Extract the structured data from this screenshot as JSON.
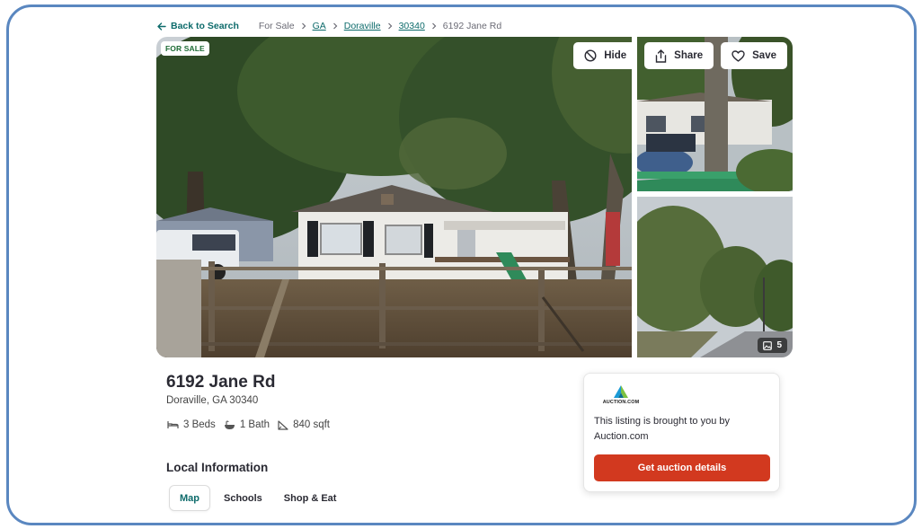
{
  "breadcrumb": {
    "back_label": "Back to Search",
    "items": [
      "For Sale",
      "GA",
      "Doraville",
      "30340",
      "6192 Jane Rd"
    ]
  },
  "gallery": {
    "sale_badge": "FOR SALE",
    "hide_label": "Hide",
    "share_label": "Share",
    "save_label": "Save",
    "photo_count": "5",
    "icons": [
      "hide-icon",
      "share-icon",
      "heart-icon",
      "photo-icon"
    ]
  },
  "listing": {
    "address": "6192 Jane Rd",
    "city_line": "Doraville, GA 30340",
    "beds": "3 Beds",
    "baths": "1 Bath",
    "sqft": "840 sqft",
    "icons": [
      "bed-icon",
      "bath-icon",
      "sqft-icon"
    ]
  },
  "local_info": {
    "title": "Local Information",
    "tabs": [
      "Map",
      "Schools",
      "Shop & Eat"
    ],
    "active_tab": "Map"
  },
  "auction_card": {
    "logo_text": "AUCTION.COM",
    "text": "This listing is brought to you by Auction.com",
    "cta_label": "Get auction details"
  },
  "colors": {
    "frame": "#5a87c0",
    "link_teal": "#0d6b6b",
    "cta_red": "#d2391f",
    "sale_green": "#1d6b35"
  }
}
